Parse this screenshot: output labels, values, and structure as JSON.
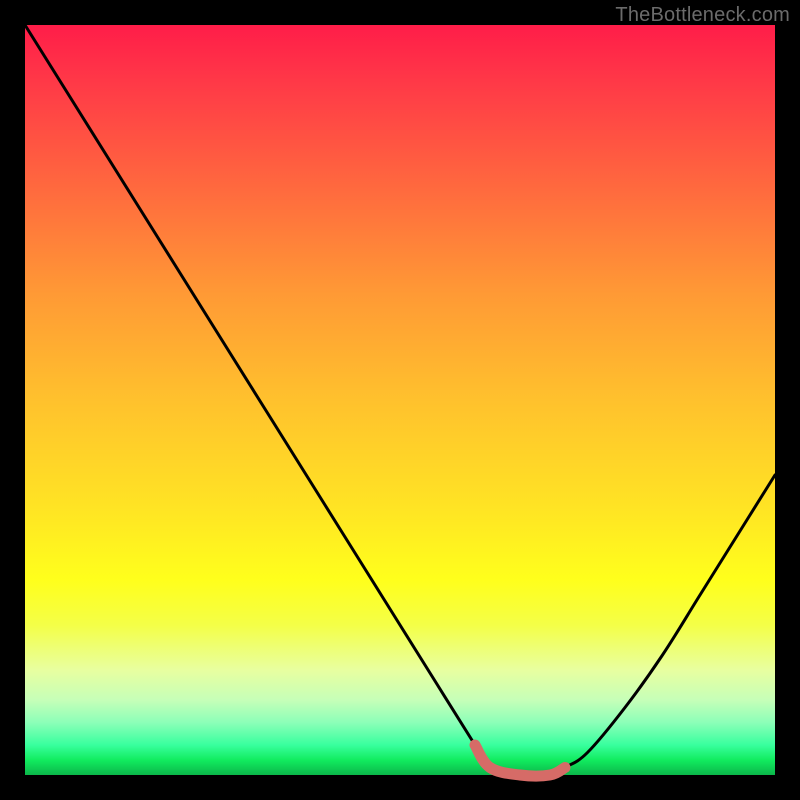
{
  "attribution": "TheBottleneck.com",
  "colors": {
    "frame": "#000000",
    "curve": "#000000",
    "marker": "#d66b67",
    "gradient_stops": [
      "#ff1d49",
      "#ff3a47",
      "#ff6a3e",
      "#ff9a35",
      "#ffc12d",
      "#ffe324",
      "#ffff1c",
      "#f4ff47",
      "#e8ffa0",
      "#c6ffb8",
      "#8cffb8",
      "#38ff9e",
      "#11ec5f",
      "#0bb64a"
    ]
  },
  "chart_data": {
    "type": "line",
    "title": "",
    "xlabel": "",
    "ylabel": "",
    "xlim": [
      0,
      100
    ],
    "ylim": [
      0,
      100
    ],
    "grid": false,
    "legend": false,
    "series": [
      {
        "name": "bottleneck-curve",
        "x": [
          0,
          5,
          10,
          15,
          20,
          25,
          30,
          35,
          40,
          45,
          50,
          55,
          60,
          62,
          66,
          70,
          72,
          75,
          80,
          85,
          90,
          95,
          100
        ],
        "y": [
          100,
          92,
          84,
          76,
          68,
          60,
          52,
          44,
          36,
          28,
          20,
          12,
          4,
          1,
          0,
          0,
          1,
          3,
          9,
          16,
          24,
          32,
          40
        ]
      }
    ],
    "highlight": {
      "name": "optimal-range",
      "x": [
        60,
        62,
        66,
        70,
        72
      ],
      "y": [
        4,
        1,
        0,
        0,
        1
      ]
    }
  }
}
